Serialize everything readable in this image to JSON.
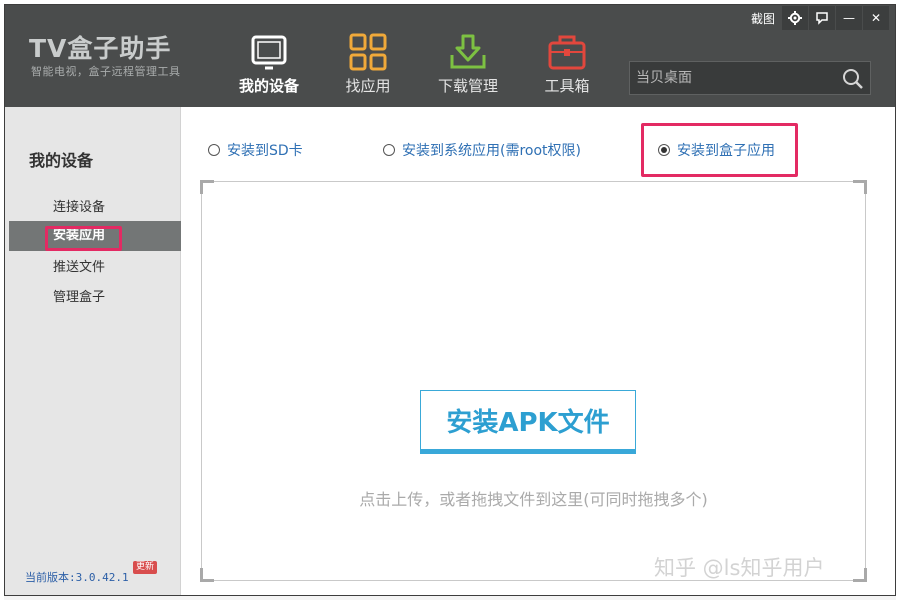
{
  "app": {
    "title": "TV盒子助手",
    "subtitle": "智能电视，盒子远程管理工具"
  },
  "window_controls": {
    "screenshot_label": "截图",
    "settings_icon": "gear-icon",
    "feedback_icon": "chat-bubble-icon",
    "minimize_symbol": "—",
    "close_symbol": "✕"
  },
  "nav": {
    "items": [
      {
        "label": "我的设备",
        "icon": "tablet-icon",
        "active": true
      },
      {
        "label": "找应用",
        "icon": "grid-apps-icon",
        "active": false
      },
      {
        "label": "下载管理",
        "icon": "download-icon",
        "active": false
      },
      {
        "label": "工具箱",
        "icon": "toolbox-icon",
        "active": false
      }
    ]
  },
  "search": {
    "placeholder": "当贝桌面"
  },
  "sidebar": {
    "title": "我的设备",
    "items": [
      {
        "label": "连接设备",
        "active": false
      },
      {
        "label": "安装应用",
        "active": true
      },
      {
        "label": "推送文件",
        "active": false
      },
      {
        "label": "管理盒子",
        "active": false
      }
    ],
    "version_label": "当前版本:3.0.42.1",
    "update_badge": "更新"
  },
  "install_options": {
    "options": [
      {
        "label": "安装到SD卡",
        "checked": false
      },
      {
        "label": "安装到系统应用(需root权限)",
        "checked": false
      },
      {
        "label": "安装到盒子应用",
        "checked": true
      }
    ]
  },
  "dropzone": {
    "button_label": "安装APK文件",
    "hint": "点击上传，或者拖拽文件到这里(可同时拖拽多个)"
  },
  "watermark": "知乎 @ls知乎用户",
  "colors": {
    "header_bg": "#4a4c4c",
    "accent_blue": "#2d9fd1",
    "highlight_pink": "#e32a63",
    "sidebar_active_bg": "#737676"
  }
}
